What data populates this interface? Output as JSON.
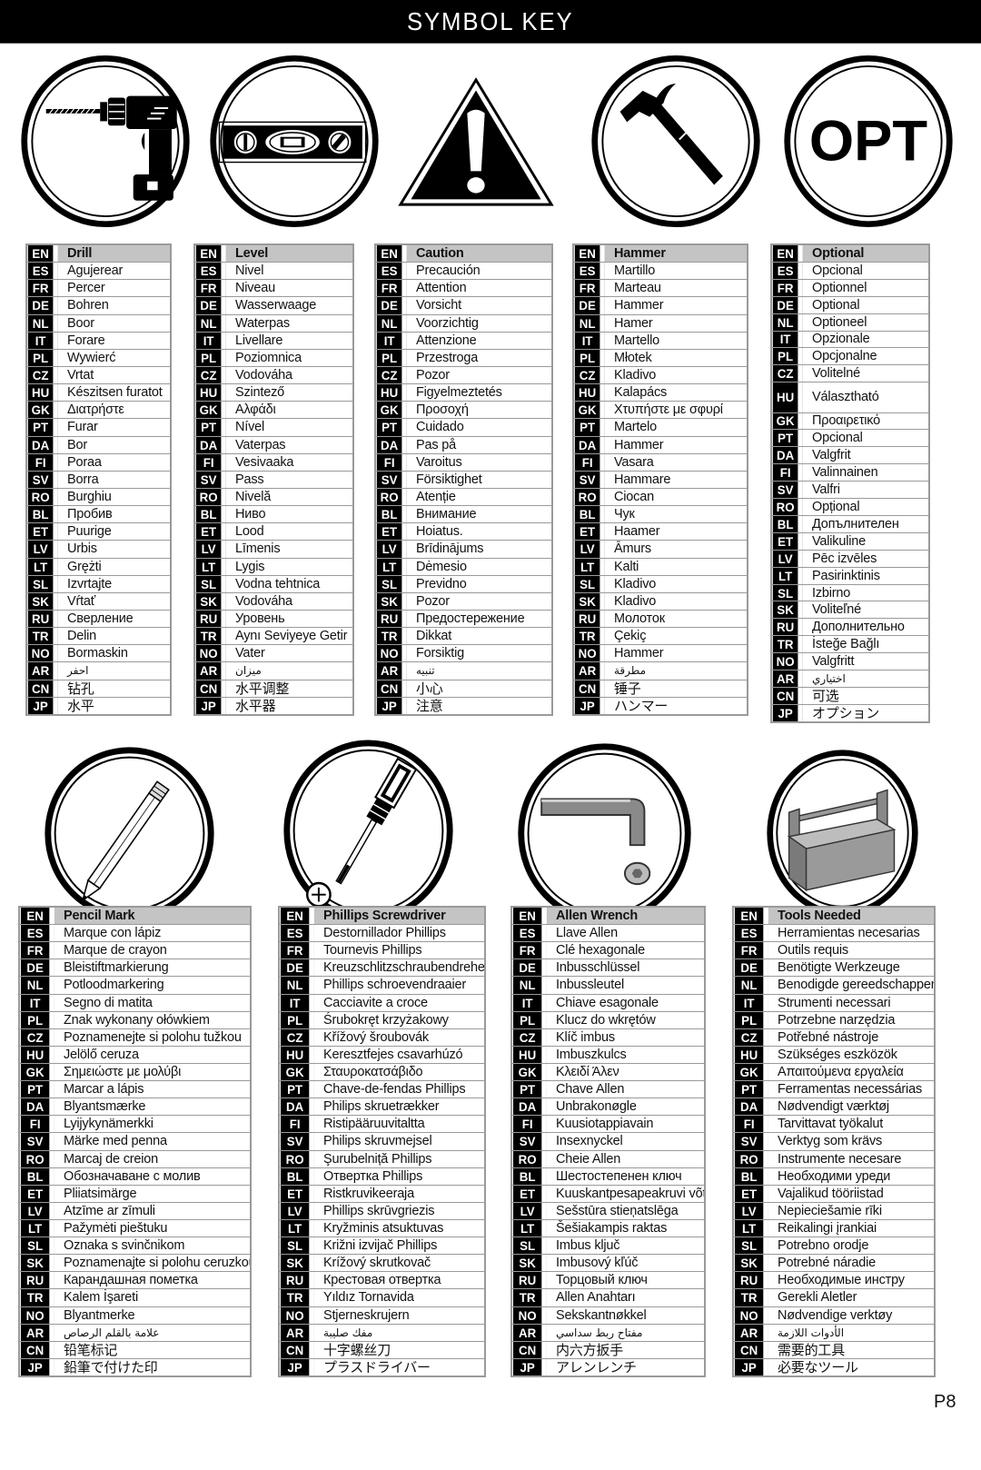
{
  "header": {
    "title": "SYMBOL KEY"
  },
  "page_number": "P8",
  "languages": [
    "EN",
    "ES",
    "FR",
    "DE",
    "NL",
    "IT",
    "PL",
    "CZ",
    "HU",
    "GK",
    "PT",
    "DA",
    "FI",
    "SV",
    "RO",
    "BL",
    "ET",
    "LV",
    "LT",
    "SL",
    "SK",
    "RU",
    "TR",
    "NO",
    "AR",
    "CN",
    "JP"
  ],
  "symbols": [
    {
      "id": "drill",
      "icon": "drill-icon",
      "terms": [
        "Drill",
        "Agujerear",
        "Percer",
        "Bohren",
        "Boor",
        "Forare",
        "Wywierć",
        "Vrtat",
        "Készitsen furatot",
        "Διατρήστε",
        "Furar",
        "Bor",
        "Poraa",
        "Borra",
        "Burghiu",
        "Пробив",
        "Puurige",
        "Urbis",
        "Grężti",
        "Izvrtajte",
        "Vŕtať",
        "Сверление",
        "Delin",
        "Bormaskin",
        "احفر",
        "钻孔",
        "水平"
      ]
    },
    {
      "id": "level",
      "icon": "spirit-level-icon",
      "terms": [
        "Level",
        "Nivel",
        "Niveau",
        "Wasserwaage",
        "Waterpas",
        "Livellare",
        "Poziomnica",
        "Vodováha",
        "Szintező",
        "Αλφάδι",
        "Nível",
        "Vaterpas",
        "Vesivaaka",
        "Pass",
        "Nivelă",
        "Ниво",
        "Lood",
        "Līmenis",
        "Lygis",
        "Vodna tehtnica",
        "Vodováha",
        "Уровень",
        "Aynı Seviyeye Getir",
        "Vater",
        "ميزان",
        "水平调整",
        "水平器"
      ]
    },
    {
      "id": "caution",
      "icon": "caution-triangle-icon",
      "terms": [
        "Caution",
        "Precaución",
        "Attention",
        "Vorsicht",
        "Voorzichtig",
        "Attenzione",
        "Przestroga",
        "Pozor",
        "Figyelmeztetés",
        "Προσοχή",
        "Cuidado",
        "Pas på",
        "Varoitus",
        "Försiktighet",
        "Atenție",
        "Внимание",
        "Hoiatus.",
        "Brīdinājums",
        "Dėmesio",
        "Previdno",
        "Pozor",
        "Предостережение",
        "Dikkat",
        "Forsiktig",
        "تنبيه",
        "小心",
        "注意"
      ]
    },
    {
      "id": "hammer",
      "icon": "hammer-icon",
      "terms": [
        "Hammer",
        "Martillo",
        "Marteau",
        "Hammer",
        "Hamer",
        "Martello",
        "Młotek",
        "Kladivo",
        "Kalapács",
        "Χτυπήστε με σφυρί",
        "Martelo",
        "Hammer",
        "Vasara",
        "Hammare",
        "Ciocan",
        "Чук",
        "Haamer",
        "Āmurs",
        "Kalti",
        "Kladivo",
        "Kladivo",
        "Молоток",
        "Çekiç",
        "Hammer",
        "مطرقة",
        "锤子",
        "ハンマー"
      ]
    },
    {
      "id": "optional",
      "icon": "opt-icon",
      "icon_text": "OPT",
      "terms": [
        "Optional",
        "Opcional",
        "Optionnel",
        "Optional",
        "Optioneel",
        "Opzionale",
        "Opcjonalne",
        "Volitelné",
        "Választható",
        "Προαιρετικό",
        "Opcional",
        "Valgfrit",
        "Valinnainen",
        "Valfri",
        "Opțional",
        "Допълнителен",
        "Valikuline",
        "Pēc izvēles",
        "Pasirinktinis",
        "Izbirno",
        "Voliteľné",
        "Дополнительно",
        "İsteğe Bağlı",
        "Valgfritt",
        "اختياري",
        "可选",
        "オプション"
      ]
    },
    {
      "id": "pencil-mark",
      "icon": "pencil-icon",
      "terms": [
        "Pencil Mark",
        "Marque con lápiz",
        "Marque de crayon",
        "Bleistiftmarkierung",
        "Potloodmarkering",
        "Segno di matita",
        "Znak wykonany ołówkiem",
        "Poznamenejte si polohu tužkou",
        "Jelölő ceruza",
        "Σημειώστε με μολύβι",
        "Marcar a lápis",
        "Blyantsmærke",
        "Lyijykynämerkki",
        "Märke med penna",
        "Marcaj de creion",
        "Обозначаване с молив",
        "Pliiatsimärge",
        "Atzīme ar zīmuli",
        "Pažymėti pieštuku",
        "Oznaka s svinčnikom",
        "Poznamenajte si polohu ceruzkou",
        "Карандашная пометка",
        "Kalem İşareti",
        "Blyantmerke",
        "علامة بالقلم الرصاص",
        "铅笔标记",
        "鉛筆で付けた印"
      ]
    },
    {
      "id": "phillips-screwdriver",
      "icon": "phillips-screwdriver-icon",
      "terms": [
        "Phillips Screwdriver",
        "Destornillador Phillips",
        "Tournevis Phillips",
        "Kreuzschlitzschraubendreher",
        "Phillips schroevendraaier",
        "Cacciavite a croce",
        "Śrubokręt krzyżakowy",
        "Křížový šroubovák",
        "Keresztfejes csavarhúzó",
        "Σταυροκατσάβιδο",
        "Chave-de-fendas Phillips",
        "Philips skruetrækker",
        "Ristipääruuvitaltta",
        "Philips skruvmejsel",
        "Şurubelniță Phillips",
        "Отвертка Phillips",
        "Ristkruvikeeraja",
        "Phillips skrūvgriezis",
        "Kryžminis atsuktuvas",
        "Križni izvijač Phillips",
        "Krížový skrutkovač",
        "Крестовая отвертка",
        "Yıldız Tornavida",
        "Stjerneskrujern",
        "مفك صليبة",
        "十字螺丝刀",
        "プラスドライバー"
      ]
    },
    {
      "id": "allen-wrench",
      "icon": "allen-wrench-icon",
      "terms": [
        "Allen Wrench",
        "Llave Allen",
        "Clé hexagonale",
        "Inbusschlüssel",
        "Inbussleutel",
        "Chiave esagonale",
        "Klucz do wkrętów",
        "Klíč imbus",
        "Imbuszkulcs",
        "Κλειδί Άλεν",
        "Chave Allen",
        "Unbrakonøgle",
        "Kuusiotappiavain",
        "Insexnyckel",
        "Cheie Allen",
        "Шестостепенен ключ",
        "Kuuskantpesapeakruvi võti",
        "Sešstūra stieņatslēga",
        "Šešiakampis raktas",
        "Imbus ključ",
        "Imbusový kľúč",
        "Торцовый ключ",
        "Allen Anahtarı",
        "Sekskantnøkkel",
        "مفتاح ربط سداسي",
        "内六方扳手",
        "アレンレンチ"
      ]
    },
    {
      "id": "tools-needed",
      "icon": "toolbox-icon",
      "terms": [
        "Tools Needed",
        "Herramientas necesarias",
        "Outils requis",
        "Benötigte Werkzeuge",
        "Benodigde gereedschappen",
        "Strumenti necessari",
        "Potrzebne narzędzia",
        "Potřebné nástroje",
        "Szükséges eszközök",
        "Απαιτούμενα εργαλεία",
        "Ferramentas necessárias",
        "Nødvendigt værktøj",
        "Tarvittavat työkalut",
        "Verktyg som krävs",
        "Instrumente necesare",
        "Необходими уреди",
        "Vajalikud tööriistad",
        "Nepieciešamie rīki",
        "Reikalingi įrankiai",
        "Potrebno orodje",
        "Potrebné náradie",
        "Необходимые инстру",
        "Gerekli Aletler",
        "Nødvendige verktøy",
        "الأدوات اللازمة",
        "需要的工具",
        "必要なツール"
      ]
    }
  ]
}
